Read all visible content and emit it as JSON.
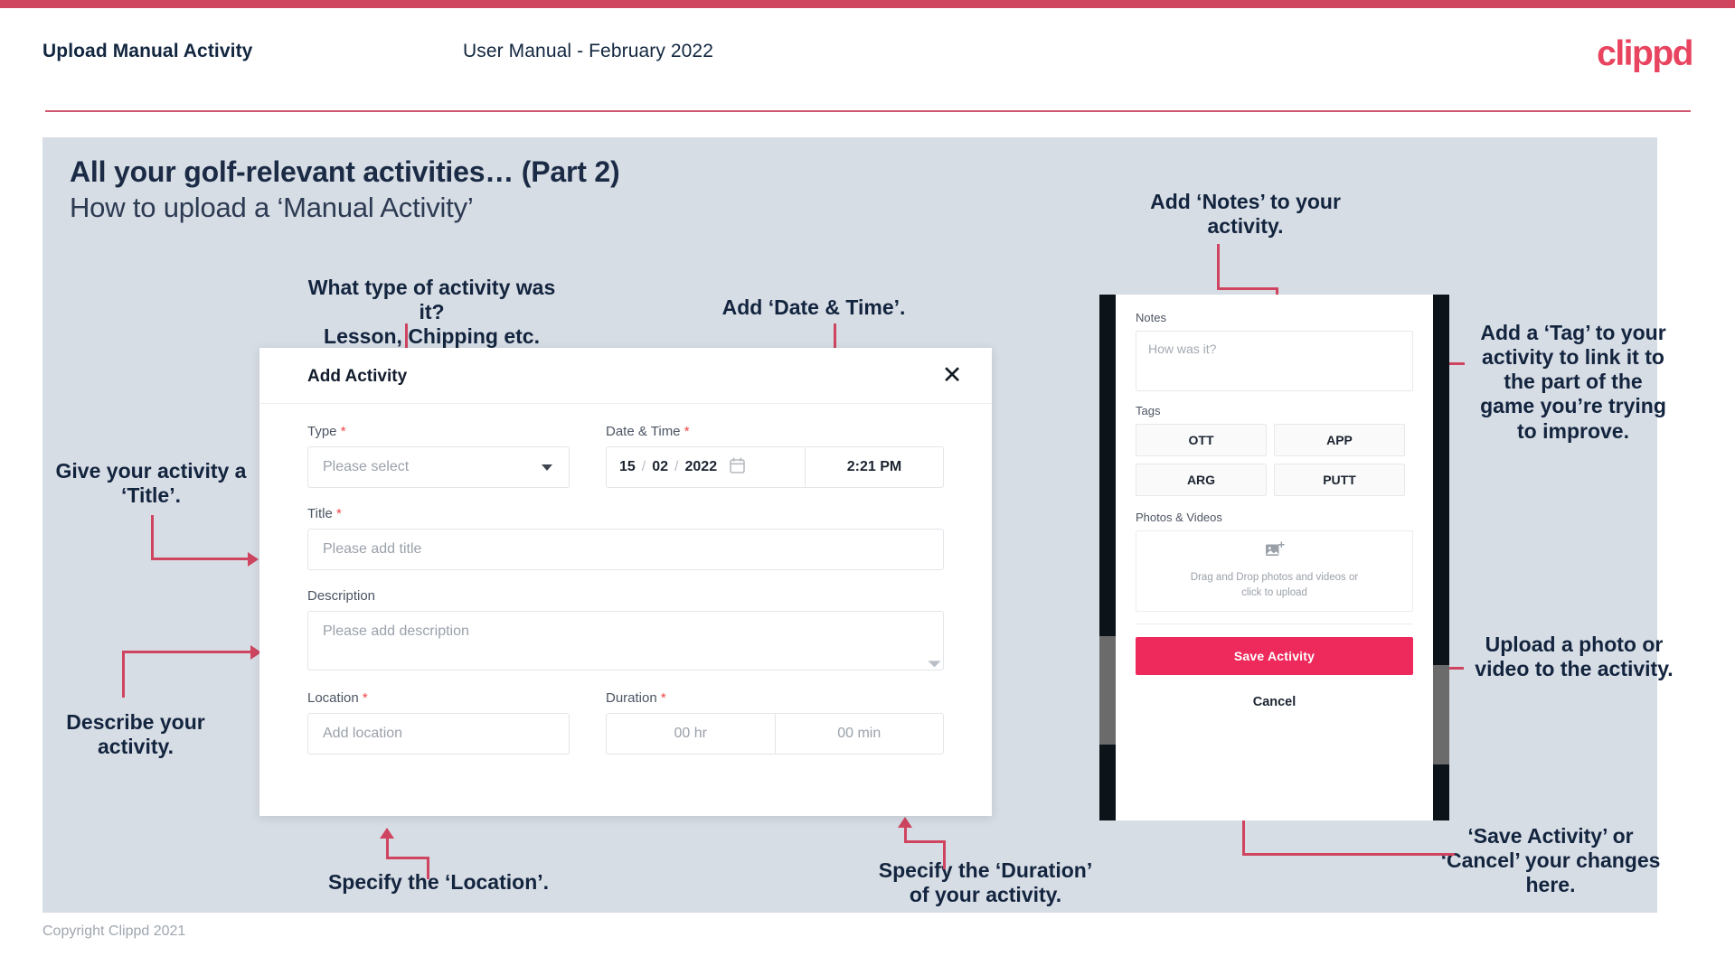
{
  "header": {
    "title": "Upload Manual Activity",
    "subtitle": "User Manual - February 2022",
    "logo": "clippd"
  },
  "slide": {
    "title": "All your golf-relevant activities… (Part 2)",
    "subtitle": "How to upload a ‘Manual Activity’"
  },
  "annotations": {
    "type": "What type of activity was it?\nLesson, Chipping etc.",
    "datetime": "Add ‘Date & Time’.",
    "title_field": "Give your activity a\n‘Title’.",
    "description": "Describe your\nactivity.",
    "location": "Specify the ‘Location’.",
    "duration": "Specify the ‘Duration’\nof your activity.",
    "notes": "Add ‘Notes’ to your\nactivity.",
    "tags": "Add a ‘Tag’ to your\nactivity to link it to\nthe part of the\ngame you’re trying\nto improve.",
    "photos": "Upload a photo or\nvideo to the activity.",
    "save": "‘Save Activity’ or\n‘Cancel’ your changes\nhere."
  },
  "dialog": {
    "title": "Add Activity",
    "close_icon": "close-icon",
    "fields": {
      "type": {
        "label": "Type",
        "required": "*",
        "placeholder": "Please select"
      },
      "datetime": {
        "label": "Date & Time",
        "required": "*",
        "day": "15",
        "month": "02",
        "year": "2022",
        "separator": "/",
        "time": "2:21 PM",
        "calendar_icon": "calendar-icon"
      },
      "title": {
        "label": "Title",
        "required": "*",
        "placeholder": "Please add title"
      },
      "description": {
        "label": "Description",
        "placeholder": "Please add description"
      },
      "location": {
        "label": "Location",
        "required": "*",
        "placeholder": "Add location"
      },
      "duration": {
        "label": "Duration",
        "required": "*",
        "hours_placeholder": "00 hr",
        "minutes_placeholder": "00 min"
      }
    }
  },
  "phone": {
    "notes": {
      "label": "Notes",
      "placeholder": "How was it?"
    },
    "tags": {
      "label": "Tags",
      "items": [
        "OTT",
        "APP",
        "ARG",
        "PUTT"
      ]
    },
    "photos": {
      "label": "Photos & Videos",
      "icon": "add-image-icon",
      "dropzone_line1": "Drag and Drop photos and videos or",
      "dropzone_line2": "click to upload"
    },
    "save_label": "Save Activity",
    "cancel_label": "Cancel"
  },
  "footer": {
    "copyright": "Copyright Clippd 2021"
  },
  "colors": {
    "accent": "#cf4560",
    "brand": "#e8445f",
    "save_button": "#ED2A5B",
    "slide_bg": "#d7dde5",
    "text_dark": "#13243e"
  }
}
